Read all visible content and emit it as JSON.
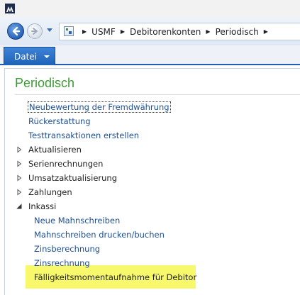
{
  "address": {
    "crumbs": [
      "USMF",
      "Debitorenkonten",
      "Periodisch"
    ]
  },
  "ribbon": {
    "datei_label": "Datei"
  },
  "page": {
    "title": "Periodisch",
    "links": [
      "Neubewertung der Fremdwährung",
      "Rückerstattung",
      "Testtransaktionen erstellen"
    ],
    "groups": [
      {
        "label": "Aktualisieren",
        "expanded": false
      },
      {
        "label": "Serienrechnungen",
        "expanded": false
      },
      {
        "label": "Umsatzaktualisierung",
        "expanded": false
      },
      {
        "label": "Zahlungen",
        "expanded": false
      },
      {
        "label": "Inkassi",
        "expanded": true
      }
    ],
    "inkassi_items": [
      "Neue Mahnschreiben",
      "Mahnschreiben drucken/buchen",
      "Zinsberechnung",
      "Zinsrechnung",
      "Fälligkeitsmomentaufnahme für Debitor"
    ]
  },
  "colors": {
    "title": "#3e9a34",
    "link": "#1d4f96",
    "highlight": "#f7f86b",
    "accent": "#1c5fb4"
  },
  "icons": {
    "app": "dynamics-logo-icon",
    "back": "back-arrow-icon",
    "forward": "forward-arrow-icon",
    "address": "page-icon"
  }
}
